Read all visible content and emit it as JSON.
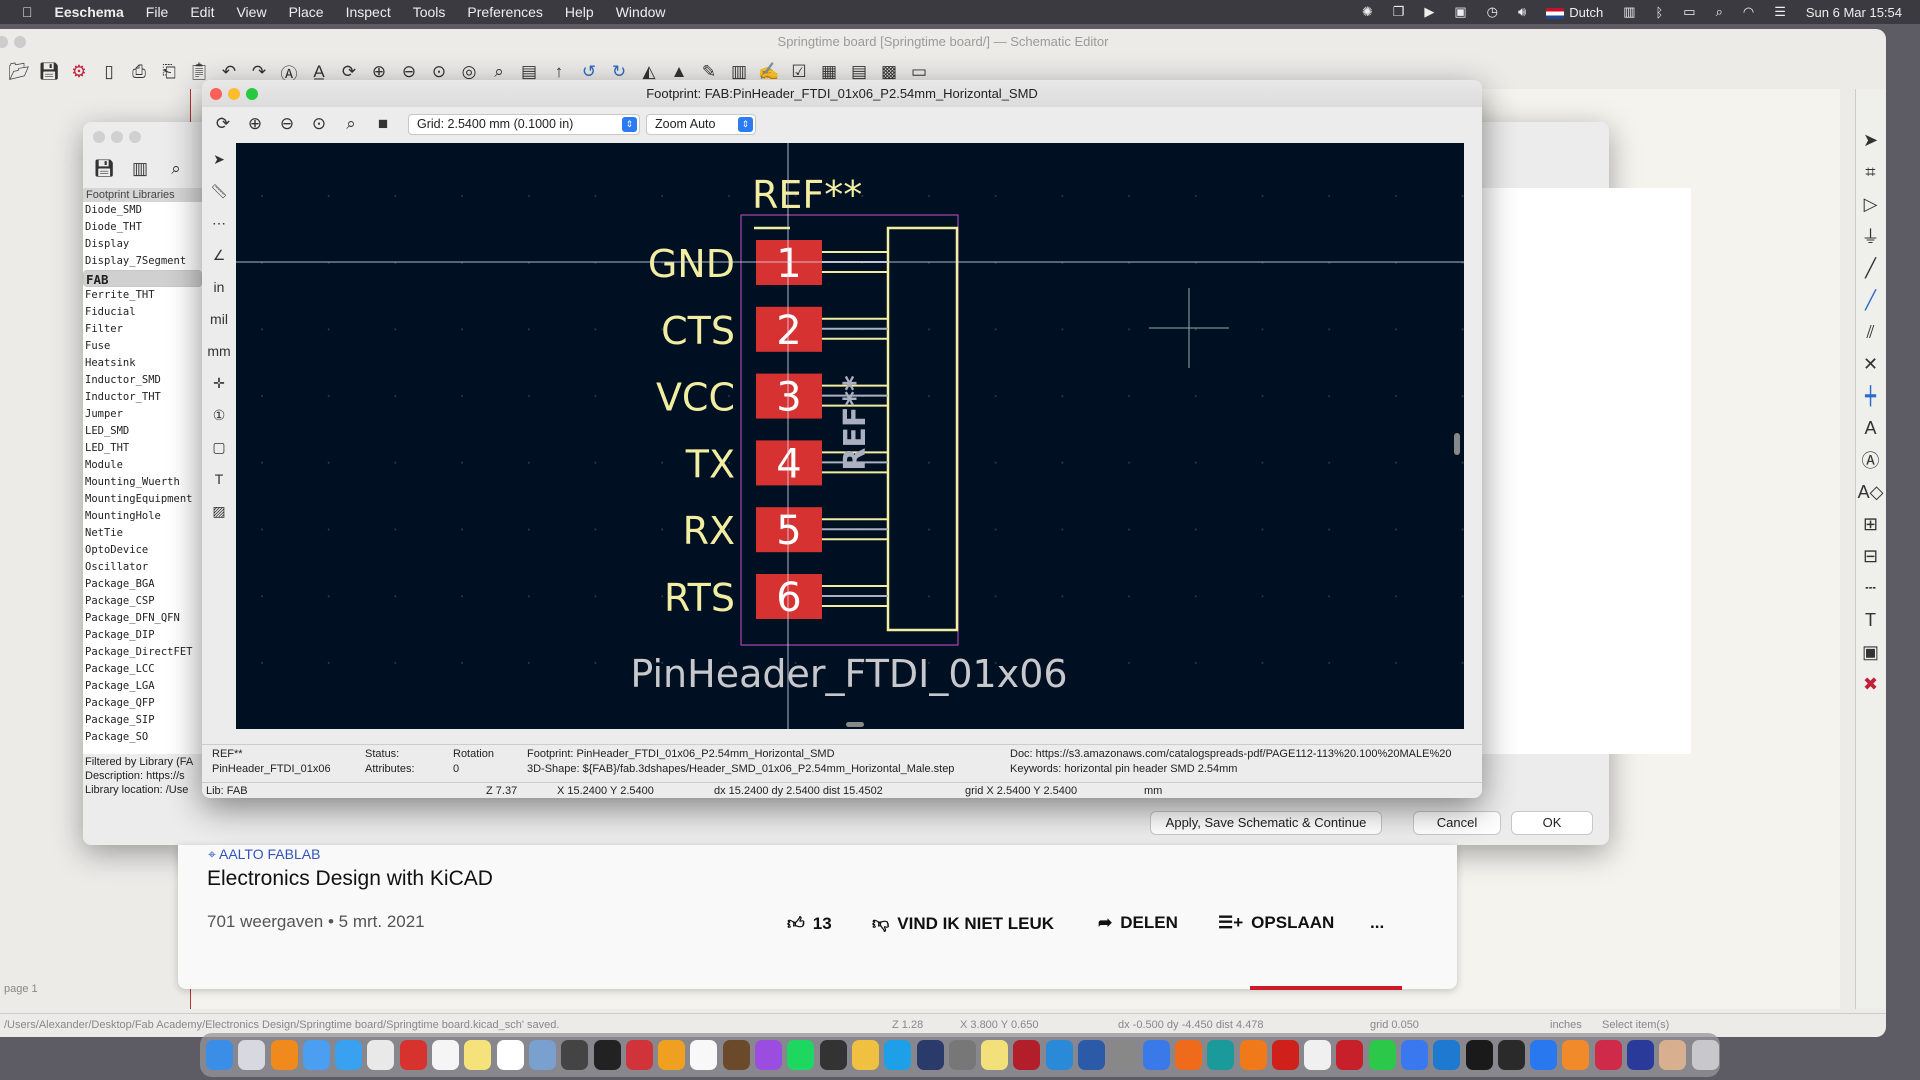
{
  "menubar": {
    "app": "Eeschema",
    "items": [
      "File",
      "Edit",
      "View",
      "Place",
      "Inspect",
      "Tools",
      "Preferences",
      "Help",
      "Window"
    ],
    "input_source": "Dutch",
    "clock": "Sun 6 Mar  15:54",
    "status_icons": [
      "sun-icon",
      "screens-icon",
      "play-icon",
      "window-icon",
      "time-machine-icon",
      "volume-icon",
      "keyboard-icon",
      "bluetooth-icon",
      "battery-icon",
      "search-icon",
      "wifi-icon",
      "control-center-icon"
    ]
  },
  "main": {
    "title": "Springtime board [Springtime board/] — Schematic Editor",
    "toolbar": [
      "open-folder-icon",
      "save-icon",
      "schematic-setup-icon",
      "page-settings-icon",
      "print-icon",
      "plot-icon",
      "paste-icon",
      "undo-icon",
      "redo-icon",
      "find-icon",
      "find-replace-icon",
      "refresh-icon",
      "zoom-in-icon",
      "zoom-out-icon",
      "zoom-fit-icon",
      "zoom-objects-icon",
      "zoom-selection-icon",
      "hierarchy-icon",
      "leave-sheet-icon",
      "rotate-ccw-icon",
      "rotate-cw-icon",
      "mirror-v-icon",
      "mirror-h-icon",
      "symbol-editor-icon",
      "symbol-browser-icon",
      "annotate-icon",
      "erc-icon",
      "footprint-assign-icon",
      "bom-icon",
      "pcb-icon",
      "scripting-icon"
    ],
    "right_toolbar": [
      "select-icon",
      "highlight-net-icon",
      "add-symbol-icon",
      "add-power-icon",
      "add-wire-icon",
      "add-bus-icon",
      "bus-entry-icon",
      "no-connect-icon",
      "junction-icon",
      "net-label-icon",
      "global-label-icon",
      "hier-label-icon",
      "add-sheet-icon",
      "import-sheet-pin-icon",
      "add-line-icon",
      "add-text-icon",
      "add-image-icon",
      "delete-icon"
    ],
    "page_label": "page 1",
    "status": {
      "message": "/Users/Alexander/Desktop/Fab Academy/Electronics Design/Springtime board/Springtime board.kicad_sch' saved.",
      "zoom": "Z 1.28",
      "xy": "X 3.800  Y 0.650",
      "delta": "dx -0.500  dy -4.450  dist 4.478",
      "grid": "grid 0.050",
      "units": "inches",
      "mode": "Select item(s)"
    }
  },
  "libbrowser": {
    "toolbar": [
      "save-icon",
      "library-icon",
      "footprint-viewer-icon"
    ],
    "header": "Footprint Libraries",
    "libraries": [
      "Diode_SMD",
      "Diode_THT",
      "Display",
      "Display_7Segment",
      "FAB",
      "Ferrite_THT",
      "Fiducial",
      "Filter",
      "Fuse",
      "Heatsink",
      "Inductor_SMD",
      "Inductor_THT",
      "Jumper",
      "LED_SMD",
      "LED_THT",
      "Module",
      "Mounting_Wuerth",
      "MountingEquipment",
      "MountingHole",
      "NetTie",
      "OptoDevice",
      "Oscillator",
      "Package_BGA",
      "Package_CSP",
      "Package_DFN_QFN",
      "Package_DIP",
      "Package_DirectFET",
      "Package_LCC",
      "Package_LGA",
      "Package_QFP",
      "Package_SIP",
      "Package_SO"
    ],
    "selected": "FAB",
    "filter_text": "Filtered by Library (FA",
    "description": "Description: https://s",
    "location": "Library location: /Use",
    "apply_button": "Apply, Save Schematic & Continue",
    "cancel_button": "Cancel",
    "ok_button": "OK"
  },
  "viewer": {
    "title": "Footprint: FAB:PinHeader_FTDI_01x06_P2.54mm_Horizontal_SMD",
    "toolbar": [
      "refresh-icon",
      "zoom-in-icon",
      "zoom-out-icon",
      "zoom-fit-icon",
      "zoom-selection-icon",
      "3d-viewer-icon"
    ],
    "grid": "Grid: 2.5400 mm (0.1000 in)",
    "zoom": "Zoom Auto",
    "left_toolbar": [
      "select-icon",
      "measure-icon",
      "grid-icon",
      "polar-icon",
      "inch-icon",
      "mil-icon",
      "mm-icon",
      "cursor-icon",
      "pad-numbers-icon",
      "pad-sketch-icon",
      "text-sketch-icon",
      "graphic-sketch-icon"
    ],
    "canvas": {
      "ref_top": "REF**",
      "ref_fab": "REF**",
      "value": "PinHeader_FTDI_01x06",
      "pins": [
        {
          "num": "1",
          "name": "GND"
        },
        {
          "num": "2",
          "name": "CTS"
        },
        {
          "num": "3",
          "name": "VCC"
        },
        {
          "num": "4",
          "name": "TX"
        },
        {
          "num": "5",
          "name": "RX"
        },
        {
          "num": "6",
          "name": "RTS"
        }
      ],
      "colors": {
        "background": "#001023",
        "pad": "#d63232",
        "silk": "#f2eda1",
        "courtyard": "#c850c8",
        "fab": "#aab0c0"
      }
    },
    "info": {
      "ref": "REF**",
      "value": "PinHeader_FTDI_01x06",
      "status_label": "Status:",
      "attributes_label": "Attributes:",
      "rotation_label": "Rotation",
      "rotation": "0",
      "footprint": "Footprint: PinHeader_FTDI_01x06_P2.54mm_Horizontal_SMD",
      "shape3d": "3D-Shape: ${FAB}/fab.3dshapes/Header_SMD_01x06_P2.54mm_Horizontal_Male.step",
      "doc": "Doc: https://s3.amazonaws.com/catalogspreads-pdf/PAGE112-113%20.100%20MALE%20",
      "keywords": "Keywords: horizontal pin header SMD 2.54mm"
    },
    "status": {
      "lib": "Lib: FAB",
      "zoom": "Z 7.37",
      "xy": "X 15.2400  Y 2.5400",
      "delta": "dx 15.2400  dy 2.5400  dist 15.4502",
      "grid": "grid X 2.5400  Y 2.5400",
      "units": "mm"
    }
  },
  "youtube": {
    "location": "AALTO FABLAB",
    "title": "Electronics Design with KiCAD",
    "meta": "701 weergaven • 5 mrt. 2021",
    "likes": "13",
    "dislike": "VIND IK NIET LEUK",
    "share": "DELEN",
    "save": "OPSLAAN",
    "more": "..."
  },
  "dock": [
    {
      "name": "finder",
      "color": "#3a8ee6"
    },
    {
      "name": "launchpad",
      "color": "#d8d8e0"
    },
    {
      "name": "vlc",
      "color": "#f08a1c"
    },
    {
      "name": "mail",
      "color": "#4b9ef0"
    },
    {
      "name": "safari",
      "color": "#3aa0f0"
    },
    {
      "name": "chrome",
      "color": "#e9e9e9"
    },
    {
      "name": "vivaldi",
      "color": "#d8322e"
    },
    {
      "name": "reminders",
      "color": "#f5f5f5"
    },
    {
      "name": "notes",
      "color": "#f5e27a"
    },
    {
      "name": "calendar",
      "color": "#ffffff"
    },
    {
      "name": "preview",
      "color": "#7aa0d0"
    },
    {
      "name": "calculator",
      "color": "#444"
    },
    {
      "name": "terminal",
      "color": "#222"
    },
    {
      "name": "pdf-app",
      "color": "#d0343a"
    },
    {
      "name": "sketch",
      "color": "#f0a020"
    },
    {
      "name": "dictionary",
      "color": "#f8f8f8"
    },
    {
      "name": "guitar",
      "color": "#6a4a2a"
    },
    {
      "name": "podcasts",
      "color": "#9b4de0"
    },
    {
      "name": "spotify",
      "color": "#1ed760"
    },
    {
      "name": "skype-s",
      "color": "#333"
    },
    {
      "name": "photos",
      "color": "#f0c040"
    },
    {
      "name": "skype",
      "color": "#1ea0e8"
    },
    {
      "name": "x-app",
      "color": "#2a3a6a"
    },
    {
      "name": "pen",
      "color": "#777"
    },
    {
      "name": "stickies",
      "color": "#f2e07a"
    },
    {
      "name": "bbedit",
      "color": "#b21e2a"
    },
    {
      "name": "fabric",
      "color": "#2a8ad8"
    },
    {
      "name": "word",
      "color": "#2b5aa8"
    },
    {
      "name": "scanner",
      "color": "#888"
    },
    {
      "name": "arc",
      "color": "#3a7ae8"
    },
    {
      "name": "firefox",
      "color": "#f06a1c"
    },
    {
      "name": "edge",
      "color": "#1a9a9a"
    },
    {
      "name": "books",
      "color": "#f07a1a"
    },
    {
      "name": "acrobat",
      "color": "#d0201a"
    },
    {
      "name": "slack",
      "color": "#f0f0f0"
    },
    {
      "name": "lastpass",
      "color": "#c8202a"
    },
    {
      "name": "whatsapp",
      "color": "#2cc84a"
    },
    {
      "name": "signal",
      "color": "#3a78f0"
    },
    {
      "name": "vscode",
      "color": "#1e7ad0"
    },
    {
      "name": "terminal2",
      "color": "#1a1a1a"
    },
    {
      "name": "github",
      "color": "#2a2a2a"
    },
    {
      "name": "zoom",
      "color": "#2a78f0"
    },
    {
      "name": "blender",
      "color": "#f08a2a"
    },
    {
      "name": "settings-app",
      "color": "#d02a4a"
    },
    {
      "name": "kicad",
      "color": "#2a3a9a"
    },
    {
      "name": "archive",
      "color": "#d8b090"
    },
    {
      "name": "trash",
      "color": "#c8c8cc"
    }
  ]
}
